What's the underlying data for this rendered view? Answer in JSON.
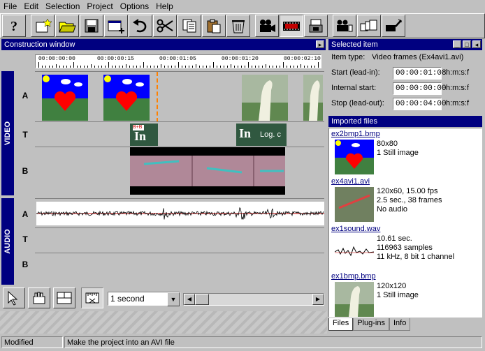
{
  "menu": [
    "File",
    "Edit",
    "Selection",
    "Project",
    "Options",
    "Help"
  ],
  "toolbar": {
    "buttons": [
      "help-icon",
      "new-star-icon",
      "open-folder-icon",
      "save-disk-icon",
      "new-window-icon",
      "undo-icon",
      "cut-scissors-icon",
      "copy-icon",
      "paste-icon",
      "delete-bin-icon",
      "camera-icon",
      "film-strip-icon",
      "film-folder-icon",
      "group-icon",
      "stack-icon",
      "wizard-icon"
    ]
  },
  "construction": {
    "title": "Construction window",
    "ruler": [
      "00:00:00:00",
      "00:00:00:15",
      "00:00:01:05",
      "00:00:01:20",
      "00:00:02:10"
    ],
    "video_label": "VIDEO",
    "audio_label": "AUDIO",
    "tracks": [
      "A",
      "T",
      "B",
      "A",
      "T",
      "B"
    ],
    "clip_text": {
      "logo1": "In",
      "logo2": "In",
      "log_caption": "Log. c"
    }
  },
  "selected": {
    "title": "Selected item",
    "item_type_label": "Item type:",
    "item_type_value": "Video frames (Ex4avi1.avi)",
    "start_label": "Start (lead-in):",
    "start_value": "00:00:01:08",
    "internal_label": "Internal start:",
    "internal_value": "00:00:00:00",
    "stop_label": "Stop (lead-out):",
    "stop_value": "00:00:04:00",
    "unit": "h:m:s:f"
  },
  "imported": {
    "title": "Imported files",
    "items": [
      {
        "name": "ex2bmp1.bmp",
        "lines": [
          "80x80",
          "1 Still image"
        ]
      },
      {
        "name": "ex4avi1.avi",
        "lines": [
          "120x60, 15.00 fps",
          "2.5 sec., 38 frames",
          "No audio"
        ]
      },
      {
        "name": "ex1sound.wav",
        "lines": [
          "10.61 sec.",
          "116963 samples",
          "11 kHz, 8 bit 1 channel"
        ]
      },
      {
        "name": "ex1bmp.bmp",
        "lines": [
          "120x120",
          "1 Still image"
        ]
      }
    ],
    "tabs": [
      "Files",
      "Plug-ins",
      "Info"
    ]
  },
  "bottom": {
    "zoom_value": "1 second"
  },
  "status": {
    "mode": "Modified",
    "message": "Make the project into an AVI file"
  }
}
